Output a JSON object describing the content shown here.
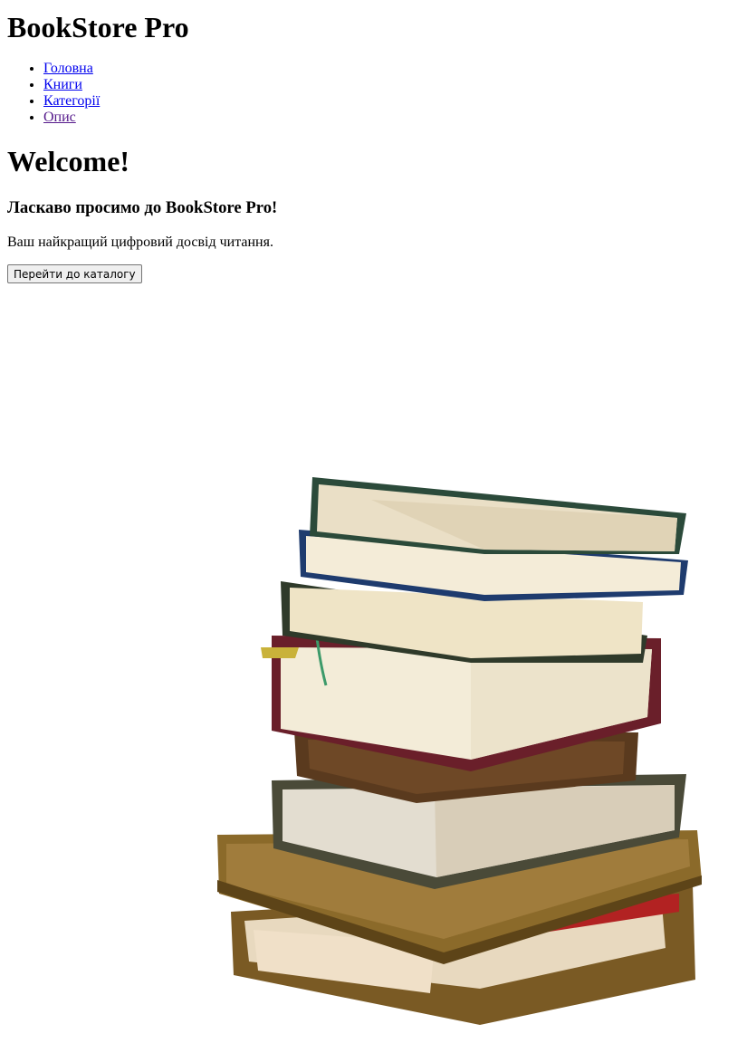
{
  "header": {
    "site_title": "BookStore Pro"
  },
  "nav": {
    "items": [
      {
        "label": "Головна"
      },
      {
        "label": "Книги"
      },
      {
        "label": "Категорії"
      },
      {
        "label": "Опис"
      }
    ]
  },
  "main": {
    "heading": "Welcome!",
    "tagline": "Ласкаво просимо до BookStore Pro!",
    "description": "Ваш найкращий цифровий досвід читання.",
    "catalog_button": "Перейти до каталогу"
  },
  "colors": {
    "link": "#0000ee",
    "link_visited": "#551a8b",
    "background": "#ffffff"
  },
  "hero": {
    "image": "stack-of-books-image"
  }
}
